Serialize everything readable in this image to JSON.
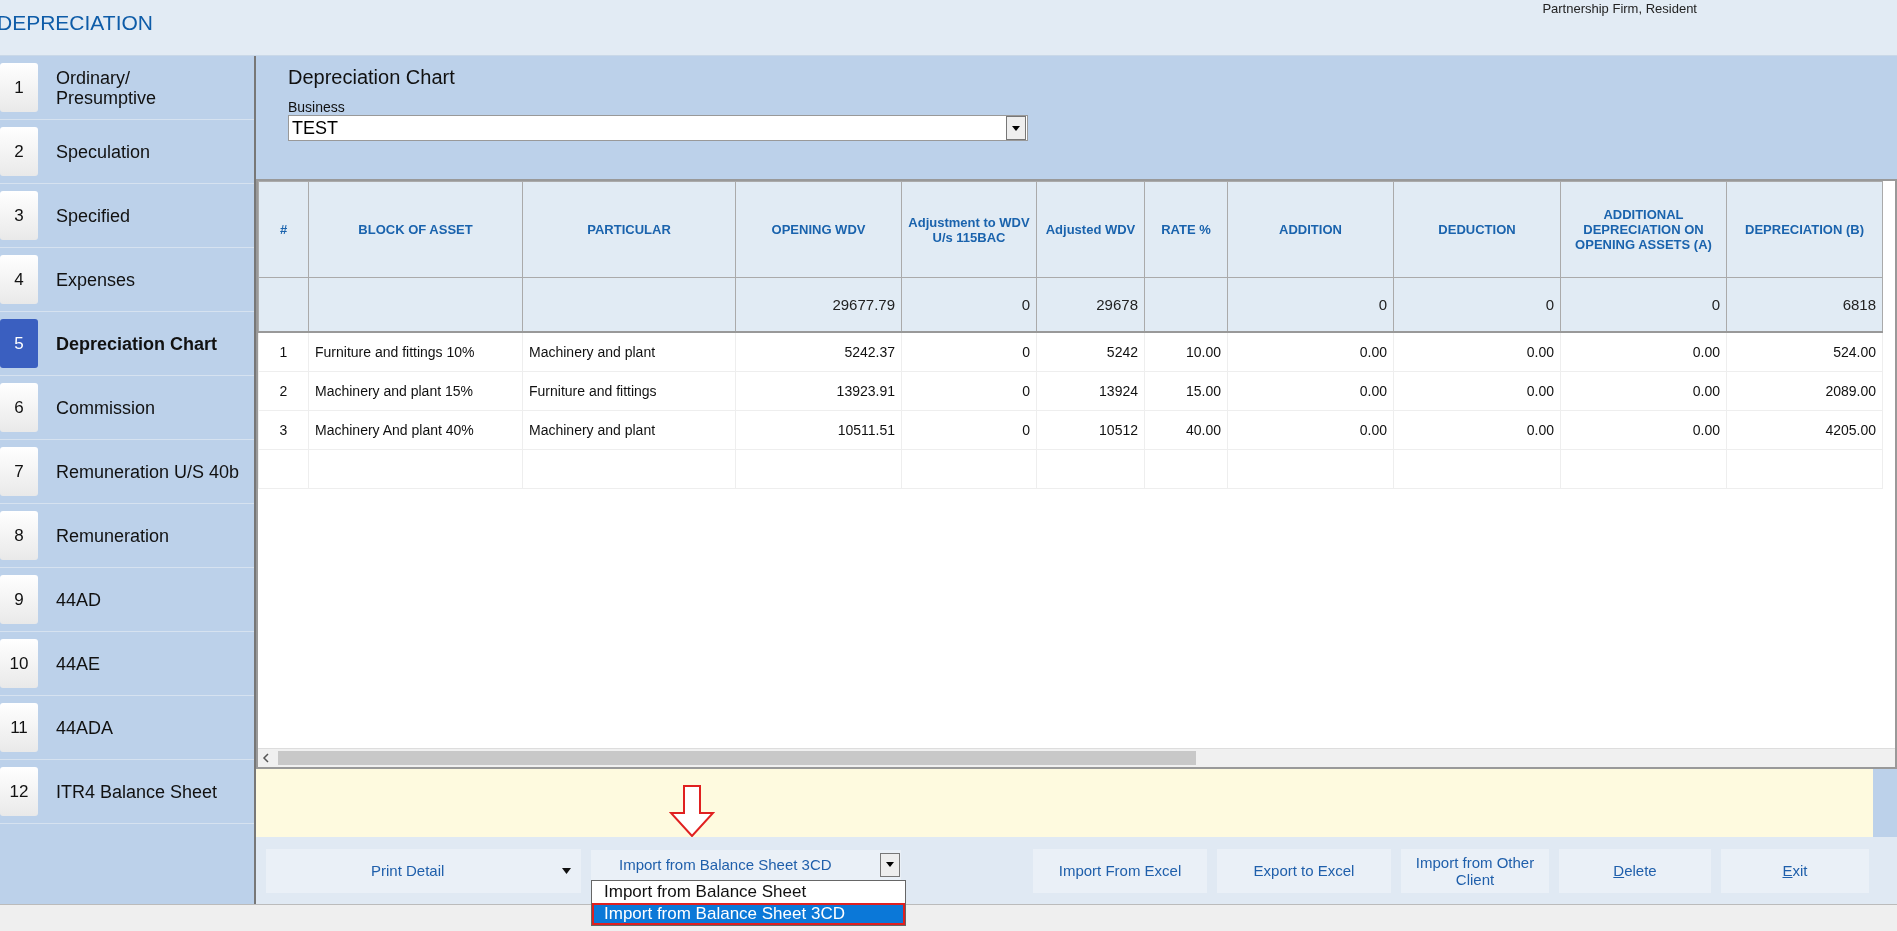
{
  "window": {
    "title": "DEPRECIATION",
    "subtitle": "Partnership Firm, Resident"
  },
  "sidebar": {
    "items": [
      {
        "number": "1",
        "label": "Ordinary/\nPresumptive",
        "selected": false
      },
      {
        "number": "2",
        "label": "Speculation",
        "selected": false
      },
      {
        "number": "3",
        "label": "Specified",
        "selected": false
      },
      {
        "number": "4",
        "label": "Expenses",
        "selected": false
      },
      {
        "number": "5",
        "label": "Depreciation Chart",
        "selected": true
      },
      {
        "number": "6",
        "label": "Commission",
        "selected": false
      },
      {
        "number": "7",
        "label": "Remuneration U/S 40b",
        "selected": false
      },
      {
        "number": "8",
        "label": "Remuneration",
        "selected": false
      },
      {
        "number": "9",
        "label": "44AD",
        "selected": false
      },
      {
        "number": "10",
        "label": "44AE",
        "selected": false
      },
      {
        "number": "11",
        "label": "44ADA",
        "selected": false
      },
      {
        "number": "12",
        "label": "ITR4 Balance Sheet",
        "selected": false
      }
    ]
  },
  "page": {
    "title": "Depreciation Chart",
    "business_label": "Business",
    "business_value": "TEST"
  },
  "table": {
    "columns": [
      "#",
      "BLOCK OF ASSET",
      "PARTICULAR",
      "OPENING WDV",
      "Adjustment to WDV U/s 115BAC",
      "Adjusted WDV",
      "RATE %",
      "ADDITION",
      "DEDUCTION",
      "ADDITIONAL DEPRECIATION ON OPENING ASSETS (A)",
      "DEPRECIATION (B)"
    ],
    "totals": {
      "opening_wdv": "29677.79",
      "adjustment": "0",
      "adjusted_wdv": "29678",
      "addition": "0",
      "deduction": "0",
      "additional_depreciation": "0",
      "depreciation": "6818"
    },
    "rows": [
      [
        "1",
        "Furniture and fittings 10%",
        "Machinery and plant",
        "5242.37",
        "0",
        "5242",
        "10.00",
        "0.00",
        "0.00",
        "0.00",
        "524.00"
      ],
      [
        "2",
        "Machinery and plant 15%",
        "Furniture and fittings",
        "13923.91",
        "0",
        "13924",
        "15.00",
        "0.00",
        "0.00",
        "0.00",
        "2089.00"
      ],
      [
        "3",
        "Machinery And plant 40%",
        "Machinery and plant",
        "10511.51",
        "0",
        "10512",
        "40.00",
        "0.00",
        "0.00",
        "0.00",
        "4205.00"
      ]
    ]
  },
  "toolbar": {
    "print_detail": "Print Detail",
    "import_combo": {
      "value": "Import from Balance Sheet 3CD",
      "options": [
        {
          "label": "Import from Balance Sheet",
          "selected": false,
          "annotated": false
        },
        {
          "label": "Import from Balance Sheet 3CD",
          "selected": true,
          "annotated": true
        }
      ]
    },
    "buttons": [
      {
        "label": "Import From Excel",
        "mnemonic": false
      },
      {
        "label": "Export to Excel",
        "mnemonic": false
      },
      {
        "label": "Import from Other Client",
        "mnemonic": false
      },
      {
        "label": "Delete",
        "mnemonic": true
      },
      {
        "label": "Exit",
        "mnemonic": true
      }
    ]
  }
}
